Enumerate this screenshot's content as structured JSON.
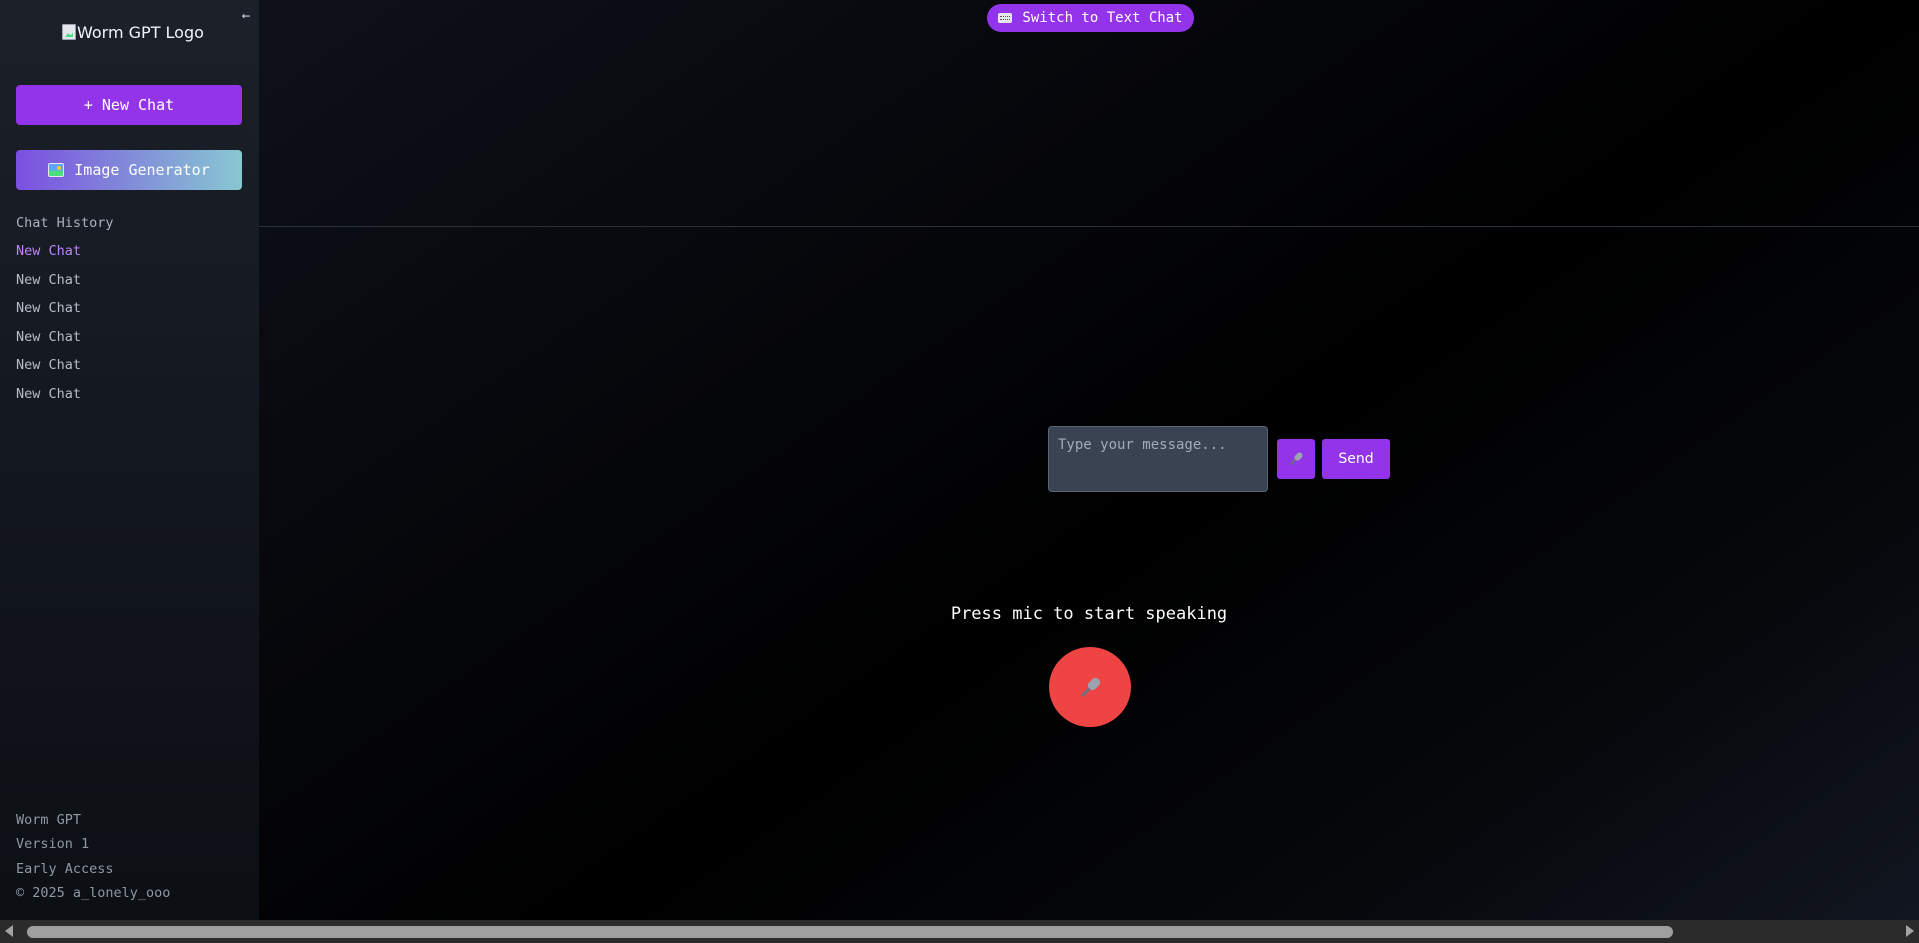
{
  "sidebar": {
    "collapse_icon": "←",
    "logo_alt": "Worm GPT Logo",
    "new_chat_label": "+ New Chat",
    "image_generator_label": "Image Generator",
    "history_title": "Chat History",
    "history": [
      {
        "label": "New Chat",
        "active": true
      },
      {
        "label": "New Chat",
        "active": false
      },
      {
        "label": "New Chat",
        "active": false
      },
      {
        "label": "New Chat",
        "active": false
      },
      {
        "label": "New Chat",
        "active": false
      },
      {
        "label": "New Chat",
        "active": false
      }
    ],
    "footer": {
      "app_name": "Worm GPT",
      "version": "Version 1",
      "stage": "Early Access",
      "copyright": "© 2025 a_lonely_ooo"
    }
  },
  "main": {
    "switch_label": "Switch to Text Chat",
    "input_placeholder": "Type your message...",
    "send_label": "Send",
    "voice_prompt": "Press mic to start speaking"
  },
  "colors": {
    "accent": "#9333ea",
    "mic": "#ef4444",
    "active_history": "#c084fc"
  },
  "icons": {
    "collapse": "arrow-left-icon",
    "image_generator": "picture-icon",
    "switch": "keyboard-icon",
    "mic": "microphone-icon"
  }
}
